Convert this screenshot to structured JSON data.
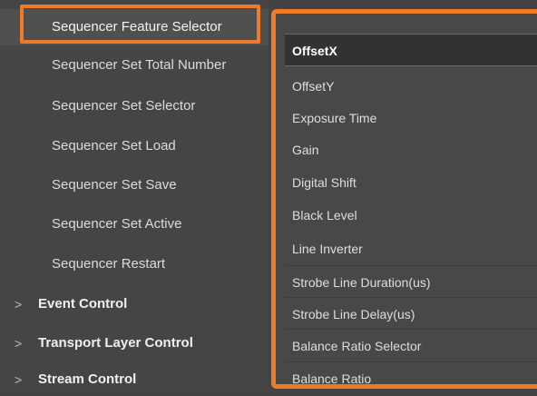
{
  "tree": {
    "items": [
      {
        "label": "Sequencer Feature Selector",
        "selected": true
      },
      {
        "label": "Sequencer Set Total Number"
      },
      {
        "label": "Sequencer Set Selector"
      },
      {
        "label": "Sequencer Set Load"
      },
      {
        "label": "Sequencer Set Save"
      },
      {
        "label": "Sequencer Set Active"
      },
      {
        "label": "Sequencer Restart"
      }
    ],
    "categories": [
      {
        "label": "Event Control",
        "icon": "chevron-right-icon",
        "glyph": ">"
      },
      {
        "label": "Transport Layer Control",
        "icon": "chevron-right-icon",
        "glyph": ">"
      },
      {
        "label": "Stream Control",
        "icon": "chevron-right-icon",
        "glyph": ">"
      }
    ]
  },
  "dropdown": {
    "selected": "OffsetX",
    "options": [
      "OffsetX",
      "OffsetY",
      "Exposure Time",
      "Gain",
      "Digital Shift",
      "Black Level",
      "Line Inverter",
      "Strobe Line Duration(us)",
      "Strobe Line Delay(us)",
      "Balance Ratio Selector",
      "Balance Ratio"
    ]
  },
  "colors": {
    "highlight": "#ef7b26",
    "background": "#434343",
    "selected_option": "#323232"
  }
}
